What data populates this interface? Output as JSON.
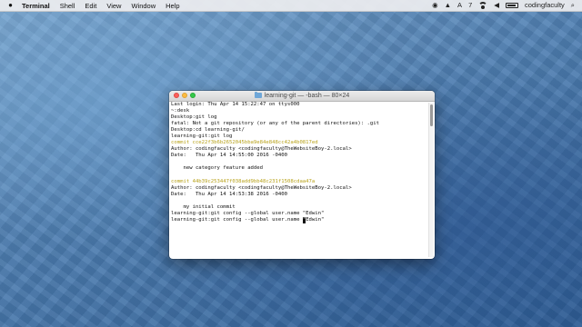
{
  "menubar": {
    "app_name": "Terminal",
    "menus": [
      "Shell",
      "Edit",
      "View",
      "Window",
      "Help"
    ],
    "status": {
      "badge_count": "7",
      "user": "codingfaculty",
      "icons": [
        "camera-icon",
        "adobe-icon",
        "a-icon",
        "wifi-icon",
        "volume-icon",
        "battery-icon",
        "search-icon"
      ]
    }
  },
  "window": {
    "title": "learning-git — -bash — 80×24"
  },
  "terminal": {
    "lines": [
      {
        "text": "Last login: Thu Apr 14 15:22:47 on ttys000",
        "type": "normal"
      },
      {
        "text": "~:desk",
        "type": "normal"
      },
      {
        "text": "Desktop:git log",
        "type": "normal"
      },
      {
        "text": "fatal: Not a git repository (or any of the parent directories): .git",
        "type": "normal"
      },
      {
        "text": "Desktop:cd learning-git/",
        "type": "normal"
      },
      {
        "text": "learning-git:git log",
        "type": "normal"
      },
      {
        "text": "commit cce22f3b6b2652045bba9e84e848cc42a4b0817ed",
        "type": "commit"
      },
      {
        "text": "Author: codingfaculty <codingfaculty@TheWebsiteBoy-2.local>",
        "type": "normal"
      },
      {
        "text": "Date:   Thu Apr 14 14:55:00 2016 -0400",
        "type": "normal"
      },
      {
        "text": "",
        "type": "normal"
      },
      {
        "text": "    new category feature added",
        "type": "normal"
      },
      {
        "text": "",
        "type": "normal"
      },
      {
        "text": "commit 44b39c253447f038add9bb48c231f1508cdaa47a",
        "type": "commit"
      },
      {
        "text": "Author: codingfaculty <codingfaculty@TheWebsiteBoy-2.local>",
        "type": "normal"
      },
      {
        "text": "Date:   Thu Apr 14 14:53:38 2016 -0400",
        "type": "normal"
      },
      {
        "text": "",
        "type": "normal"
      },
      {
        "text": "    my initial commit",
        "type": "normal"
      },
      {
        "text": "learning-git:git config --global user.name \"Edwin\"",
        "type": "normal"
      }
    ],
    "cursor_line": {
      "before": "learning-git:git config --global user.name ",
      "cursor_char": "\"",
      "after": "Edwin\""
    }
  },
  "colors": {
    "commit_hash": "#b8a21a",
    "desktop_blue": "#4f7fb2"
  }
}
